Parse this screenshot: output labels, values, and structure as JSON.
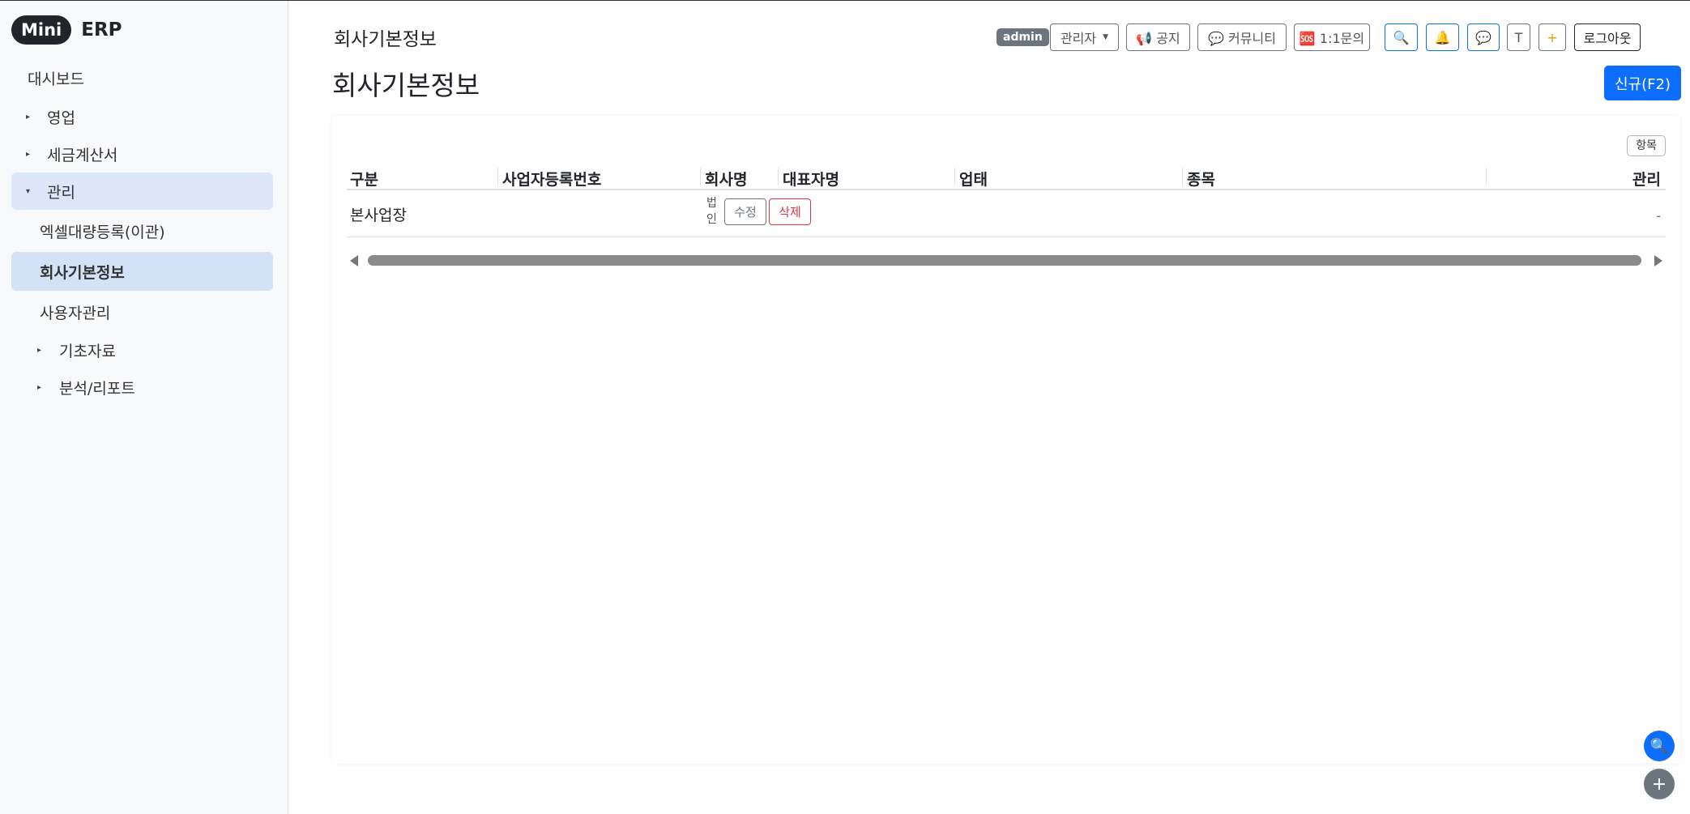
{
  "brand": {
    "pill": "Mini",
    "text": "ERP"
  },
  "sidebar": {
    "dashboard": "대시보드",
    "groups": [
      {
        "label": "영업",
        "caret": "▸"
      },
      {
        "label": "세금계산서",
        "caret": "▸"
      },
      {
        "label": "관리",
        "caret": "▾"
      }
    ],
    "sub_items": [
      {
        "label": "엑셀대량등록(이관)"
      },
      {
        "label": "회사기본정보"
      },
      {
        "label": "사용자관리"
      }
    ],
    "groups2": [
      {
        "label": "기초자료",
        "caret": "▸"
      },
      {
        "label": "분석/리포트",
        "caret": "▸"
      }
    ]
  },
  "header": {
    "title": "회사기본정보",
    "badge": "admin",
    "role_dropdown": "관리자",
    "notice": "📢 공지",
    "community": "💬 커뮤니티",
    "inquiry": "🆘 1:1문의",
    "search_icon": "🔍",
    "bell_icon": "🔔",
    "chat_icon": "💬",
    "t_button": "T",
    "plus_button": "+",
    "logout": "로그아웃"
  },
  "page": {
    "title": "회사기본정보",
    "new_button": "신규(F2)",
    "columns_button": "항목"
  },
  "table": {
    "headers": [
      "구분",
      "사업자등록번호",
      "회사명",
      "대표자명",
      "업태",
      "종목",
      "관리"
    ],
    "rows": [
      {
        "type": "본사업장",
        "legal": "법인",
        "edit": "수정",
        "delete": "삭제",
        "manage": "-"
      }
    ]
  },
  "fab": {
    "search": "🔍",
    "plus": "+"
  },
  "colors": {
    "primary": "#0d6efd",
    "danger": "#dc3545",
    "secondary": "#6c757d",
    "active_bg": "#d4e2f7"
  }
}
